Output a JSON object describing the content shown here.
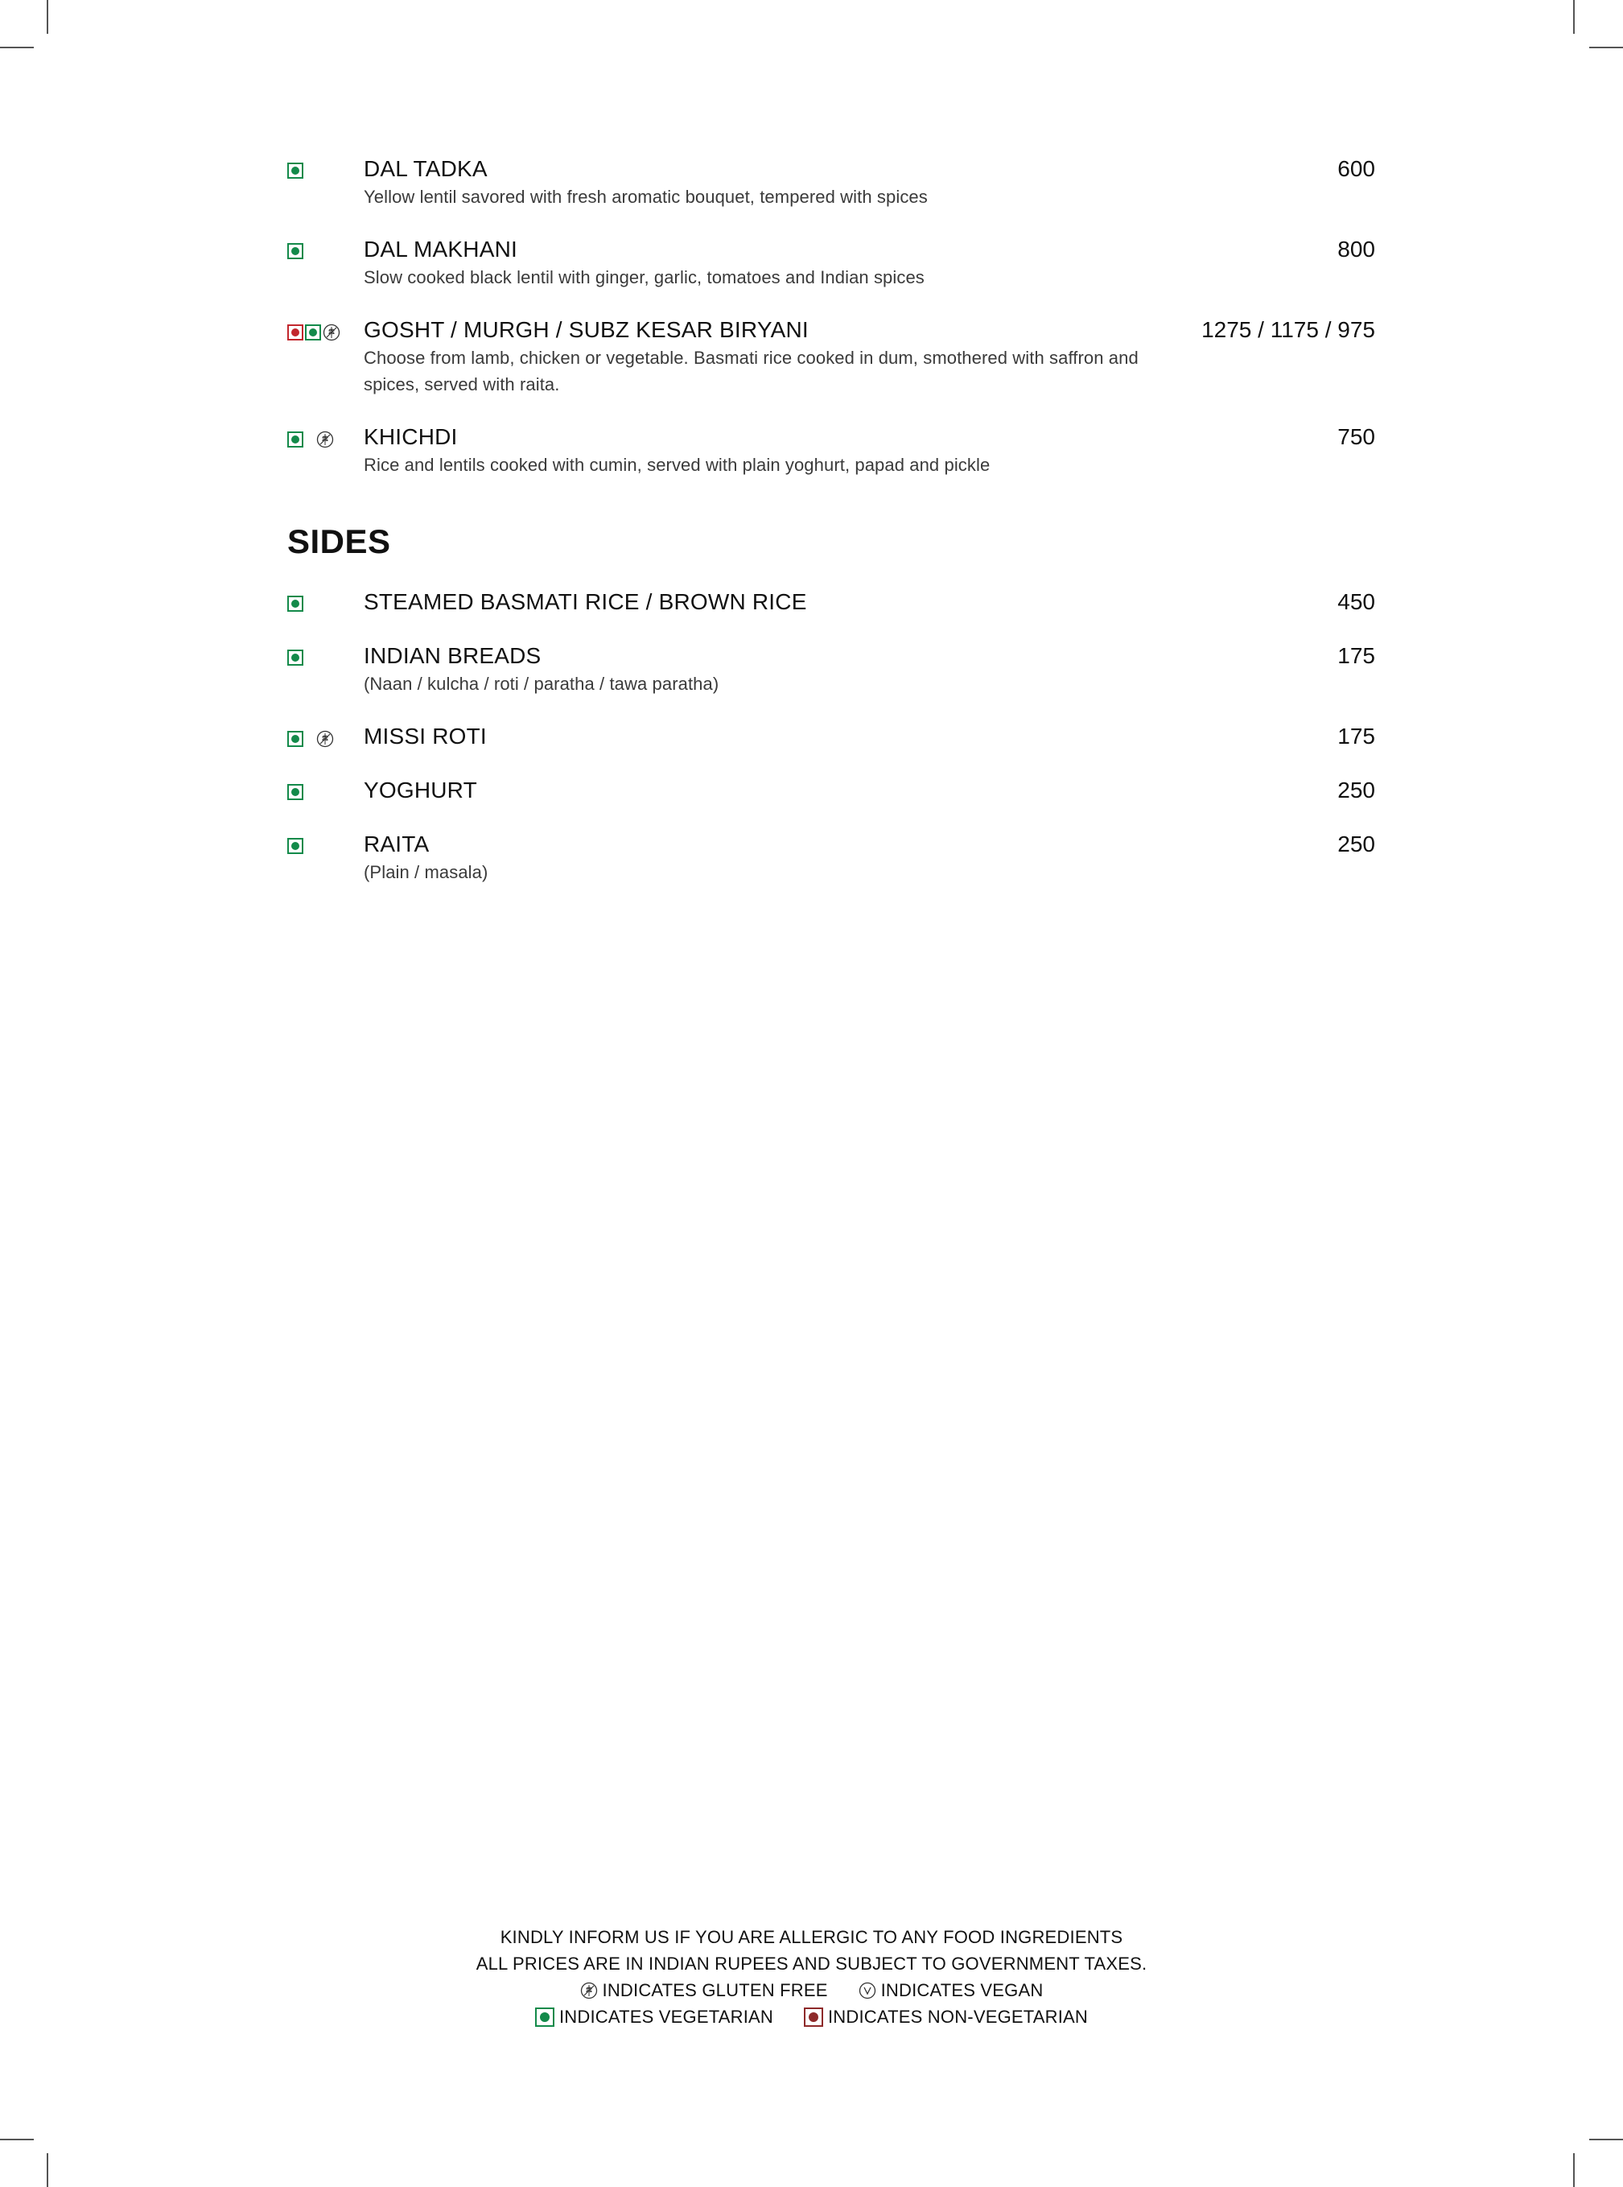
{
  "sections": [
    {
      "heading": "",
      "items": [
        {
          "name": "DAL TADKA",
          "desc": "Yellow lentil savored with fresh aromatic bouquet, tempered with spices",
          "price": "600",
          "icons": [
            "veg"
          ]
        },
        {
          "name": "DAL MAKHANI",
          "desc": "Slow cooked black lentil with ginger, garlic, tomatoes and Indian spices",
          "price": "800",
          "icons": [
            "veg"
          ]
        },
        {
          "name": "GOSHT / MURGH / SUBZ KESAR BIRYANI",
          "desc": "Choose from lamb, chicken or vegetable. Basmati rice cooked in dum, smothered with saffron and spices, served with raita.",
          "price": "1275 / 1175 / 975",
          "icons": [
            "non-veg",
            "veg",
            "gluten-free"
          ]
        },
        {
          "name": "KHICHDI",
          "desc": "Rice and lentils cooked with cumin, served with plain yoghurt, papad and pickle",
          "price": "750",
          "icons": [
            "veg",
            "gluten-free"
          ]
        }
      ]
    },
    {
      "heading": "SIDES",
      "items": [
        {
          "name": "STEAMED BASMATI RICE / BROWN RICE",
          "desc": "",
          "price": "450",
          "icons": [
            "veg"
          ]
        },
        {
          "name": "INDIAN BREADS",
          "desc": "(Naan / kulcha / roti / paratha / tawa paratha)",
          "price": "175",
          "icons": [
            "veg"
          ]
        },
        {
          "name": "MISSI ROTI",
          "desc": "",
          "price": "175",
          "icons": [
            "veg",
            "gluten-free"
          ]
        },
        {
          "name": "YOGHURT",
          "desc": "",
          "price": "250",
          "icons": [
            "veg"
          ]
        },
        {
          "name": "RAITA",
          "desc": "(Plain / masala)",
          "price": "250",
          "icons": [
            "veg"
          ]
        }
      ]
    }
  ],
  "footer": {
    "allergy_note": "KINDLY INFORM US IF YOU ARE ALLERGIC TO ANY FOOD INGREDIENTS",
    "price_note": "ALL PRICES ARE IN INDIAN RUPEES AND SUBJECT TO GOVERNMENT TAXES.",
    "gluten_free_label": "INDICATES GLUTEN FREE",
    "vegan_label": "INDICATES VEGAN",
    "vegetarian_label": "INDICATES VEGETARIAN",
    "non_vegetarian_label": "INDICATES NON-VEGETARIAN"
  },
  "colors": {
    "veg": "#138a4a",
    "non_veg": "#c2272d",
    "non_veg_legend": "#8e2a2a"
  }
}
